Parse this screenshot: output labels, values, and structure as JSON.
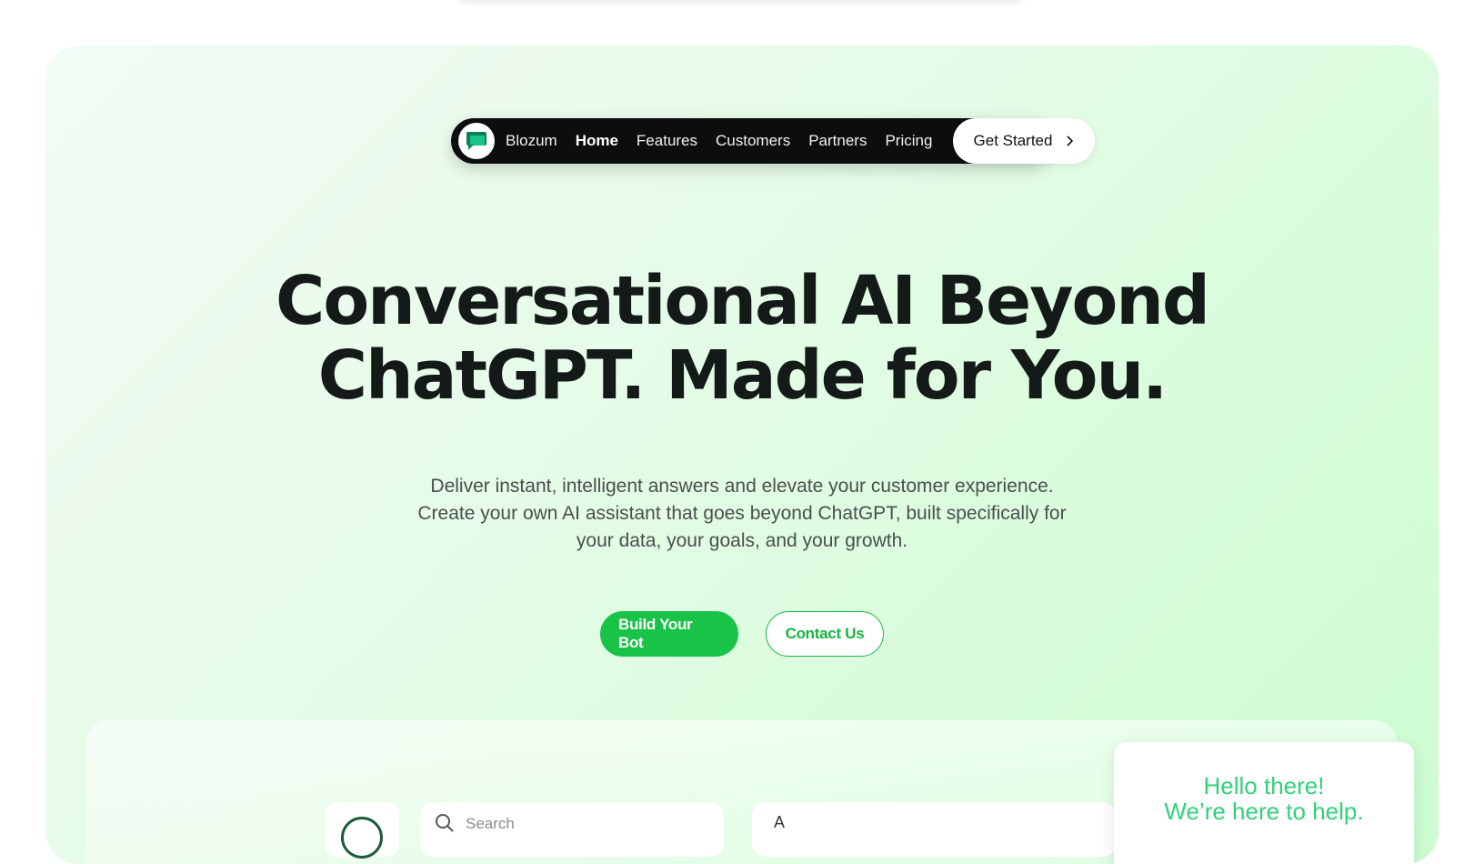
{
  "nav": {
    "brand": "Blozum",
    "items": [
      {
        "label": "Home",
        "active": true
      },
      {
        "label": "Features",
        "active": false
      },
      {
        "label": "Customers",
        "active": false
      },
      {
        "label": "Partners",
        "active": false
      },
      {
        "label": "Pricing",
        "active": false
      }
    ],
    "cta_label": "Get Started",
    "cta_icon": "chevron-right-icon"
  },
  "hero": {
    "headline_line1": "Conversational AI Beyond",
    "headline_line2": "ChatGPT. Made for You.",
    "sub_line1": "Deliver instant, intelligent answers and elevate your customer experience.",
    "sub_line2": "Create your own AI assistant that goes beyond ChatGPT, built specifically for",
    "sub_line3": "your data, your goals, and your growth.",
    "primary_button": "Build Your Bot",
    "secondary_button": "Contact Us"
  },
  "preview": {
    "search_placeholder": "Search",
    "panel_text": "A",
    "chat_line1": "Hello there!",
    "chat_line2": "We’re here to help."
  },
  "colors": {
    "accent": "#19c347",
    "nav_bg": "#0d0d0f",
    "headline": "#131a18",
    "chat_text": "#33d07a"
  }
}
